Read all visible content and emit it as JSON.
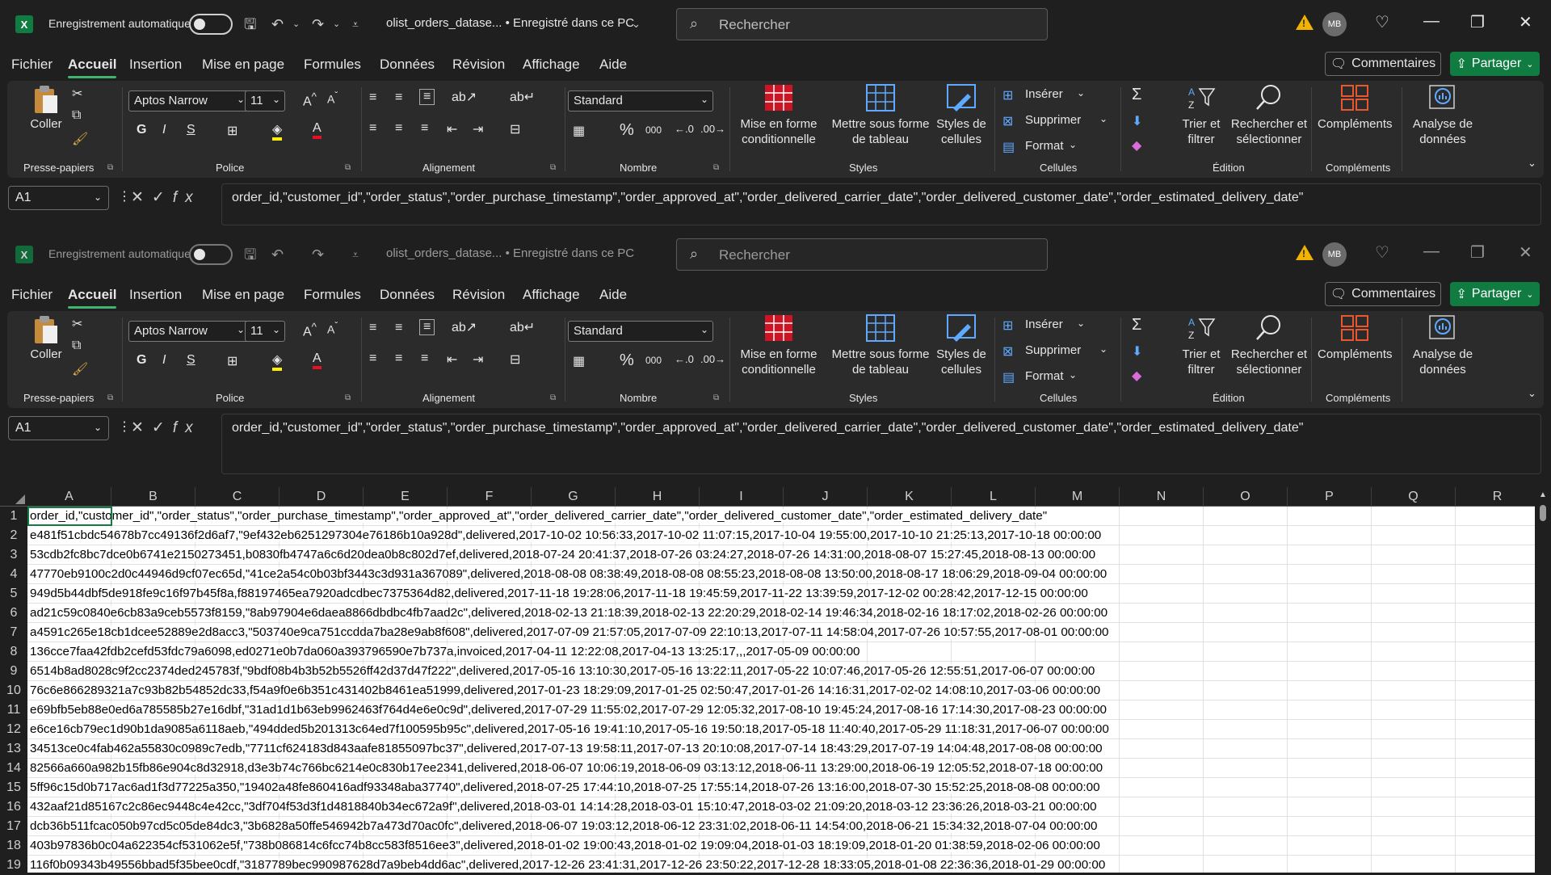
{
  "titlebar": {
    "logo": "X",
    "autosave_label": "Enregistrement automatique",
    "doc_title": "olist_orders_datase...  •  Enregistré dans ce PC",
    "search_placeholder": "Rechercher",
    "avatar_initials": "MB"
  },
  "menu": {
    "items": [
      "Fichier",
      "Accueil",
      "Insertion",
      "Mise en page",
      "Formules",
      "Données",
      "Révision",
      "Affichage",
      "Aide"
    ],
    "active": "Accueil",
    "comments_label": "Commentaires",
    "share_label": "Partager"
  },
  "ribbon": {
    "paste_label": "Coller",
    "clipboard_group": "Presse-papiers",
    "font_name": "Aptos Narrow",
    "font_size": "11",
    "font_group": "Police",
    "bold": "G",
    "italic": "I",
    "underline": "S",
    "alignment_group": "Alignement",
    "number_format": "Standard",
    "number_group": "Nombre",
    "percent": "%",
    "thousands": "000",
    "cond_format_label": "Mise en forme conditionnelle",
    "format_table_label": "Mettre sous forme de tableau",
    "cell_styles_label": "Styles de cellules",
    "styles_group": "Styles",
    "insert_label": "Insérer",
    "delete_label": "Supprimer",
    "format_label": "Format",
    "cells_group": "Cellules",
    "sort_filter_label": "Trier et filtrer",
    "find_select_label": "Rechercher et sélectionner",
    "editing_group": "Édition",
    "addins_label": "Compléments",
    "analyze_label": "Analyse de données",
    "addins_group": "Compléments"
  },
  "formula_bar": {
    "name_box": "A1",
    "fx": "fx",
    "content": "order_id,\"customer_id\",\"order_status\",\"order_purchase_timestamp\",\"order_approved_at\",\"order_delivered_carrier_date\",\"order_delivered_customer_date\",\"order_estimated_delivery_date\""
  },
  "sheet": {
    "columns": [
      "A",
      "B",
      "C",
      "D",
      "E",
      "F",
      "G",
      "H",
      "I",
      "J",
      "K",
      "L",
      "M",
      "N",
      "O",
      "P",
      "Q",
      "R"
    ],
    "row_numbers": [
      "1",
      "2",
      "3",
      "4",
      "5",
      "6",
      "7",
      "8",
      "9",
      "10",
      "11",
      "12",
      "13",
      "14",
      "15",
      "16",
      "17",
      "18",
      "19"
    ],
    "rows": [
      "order_id,\"customer_id\",\"order_status\",\"order_purchase_timestamp\",\"order_approved_at\",\"order_delivered_carrier_date\",\"order_delivered_customer_date\",\"order_estimated_delivery_date\"",
      "e481f51cbdc54678b7cc49136f2d6af7,\"9ef432eb6251297304e76186b10a928d\",delivered,2017-10-02 10:56:33,2017-10-02 11:07:15,2017-10-04 19:55:00,2017-10-10 21:25:13,2017-10-18 00:00:00",
      "53cdb2fc8bc7dce0b6741e2150273451,b0830fb4747a6c6d20dea0b8c802d7ef,delivered,2018-07-24 20:41:37,2018-07-26 03:24:27,2018-07-26 14:31:00,2018-08-07 15:27:45,2018-08-13 00:00:00",
      "47770eb9100c2d0c44946d9cf07ec65d,\"41ce2a54c0b03bf3443c3d931a367089\",delivered,2018-08-08 08:38:49,2018-08-08 08:55:23,2018-08-08 13:50:00,2018-08-17 18:06:29,2018-09-04 00:00:00",
      "949d5b44dbf5de918fe9c16f97b45f8a,f88197465ea7920adcdbec7375364d82,delivered,2017-11-18 19:28:06,2017-11-18 19:45:59,2017-11-22 13:39:59,2017-12-02 00:28:42,2017-12-15 00:00:00",
      "ad21c59c0840e6cb83a9ceb5573f8159,\"8ab97904e6daea8866dbdbc4fb7aad2c\",delivered,2018-02-13 21:18:39,2018-02-13 22:20:29,2018-02-14 19:46:34,2018-02-16 18:17:02,2018-02-26 00:00:00",
      "a4591c265e18cb1dcee52889e2d8acc3,\"503740e9ca751ccdda7ba28e9ab8f608\",delivered,2017-07-09 21:57:05,2017-07-09 22:10:13,2017-07-11 14:58:04,2017-07-26 10:57:55,2017-08-01 00:00:00",
      "136cce7faa42fdb2cefd53fdc79a6098,ed0271e0b7da060a393796590e7b737a,invoiced,2017-04-11 12:22:08,2017-04-13 13:25:17,,,2017-05-09 00:00:00",
      "6514b8ad8028c9f2cc2374ded245783f,\"9bdf08b4b3b52b5526ff42d37d47f222\",delivered,2017-05-16 13:10:30,2017-05-16 13:22:11,2017-05-22 10:07:46,2017-05-26 12:55:51,2017-06-07 00:00:00",
      "76c6e866289321a7c93b82b54852dc33,f54a9f0e6b351c431402b8461ea51999,delivered,2017-01-23 18:29:09,2017-01-25 02:50:47,2017-01-26 14:16:31,2017-02-02 14:08:10,2017-03-06 00:00:00",
      "e69bfb5eb88e0ed6a785585b27e16dbf,\"31ad1d1b63eb9962463f764d4e6e0c9d\",delivered,2017-07-29 11:55:02,2017-07-29 12:05:32,2017-08-10 19:45:24,2017-08-16 17:14:30,2017-08-23 00:00:00",
      "e6ce16cb79ec1d90b1da9085a6118aeb,\"494dded5b201313c64ed7f100595b95c\",delivered,2017-05-16 19:41:10,2017-05-16 19:50:18,2017-05-18 11:40:40,2017-05-29 11:18:31,2017-06-07 00:00:00",
      "34513ce0c4fab462a55830c0989c7edb,\"7711cf624183d843aafe81855097bc37\",delivered,2017-07-13 19:58:11,2017-07-13 20:10:08,2017-07-14 18:43:29,2017-07-19 14:04:48,2017-08-08 00:00:00",
      "82566a660a982b15fb86e904c8d32918,d3e3b74c766bc6214e0c830b17ee2341,delivered,2018-06-07 10:06:19,2018-06-09 03:13:12,2018-06-11 13:29:00,2018-06-19 12:05:52,2018-07-18 00:00:00",
      "5ff96c15d0b717ac6ad1f3d77225a350,\"19402a48fe860416adf93348aba37740\",delivered,2018-07-25 17:44:10,2018-07-25 17:55:14,2018-07-26 13:16:00,2018-07-30 15:52:25,2018-08-08 00:00:00",
      "432aaf21d85167c2c86ec9448c4e42cc,\"3df704f53d3f1d4818840b34ec672a9f\",delivered,2018-03-01 14:14:28,2018-03-01 15:10:47,2018-03-02 21:09:20,2018-03-12 23:36:26,2018-03-21 00:00:00",
      "dcb36b511fcac050b97cd5c05de84dc3,\"3b6828a50ffe546942b7a473d70ac0fc\",delivered,2018-06-07 19:03:12,2018-06-12 23:31:02,2018-06-11 14:54:00,2018-06-21 15:34:32,2018-07-04 00:00:00",
      "403b97836b0c04a622354cf531062e5f,\"738b086814c6fcc74b8cc583f8516ee3\",delivered,2018-01-02 19:00:43,2018-01-02 19:09:04,2018-01-03 18:19:09,2018-01-20 01:38:59,2018-02-06 00:00:00",
      "116f0b09343b49556bbad5f35bee0cdf,\"3187789bec990987628d7a9beb4dd6ac\",delivered,2017-12-26 23:41:31,2017-12-26 23:50:22,2017-12-28 18:33:05,2018-01-08 22:36:36,2018-01-29 00:00:00"
    ]
  },
  "colors": {
    "accent": "#107c41",
    "active_tab": "#3fb46c",
    "warning": "#f2b300"
  }
}
